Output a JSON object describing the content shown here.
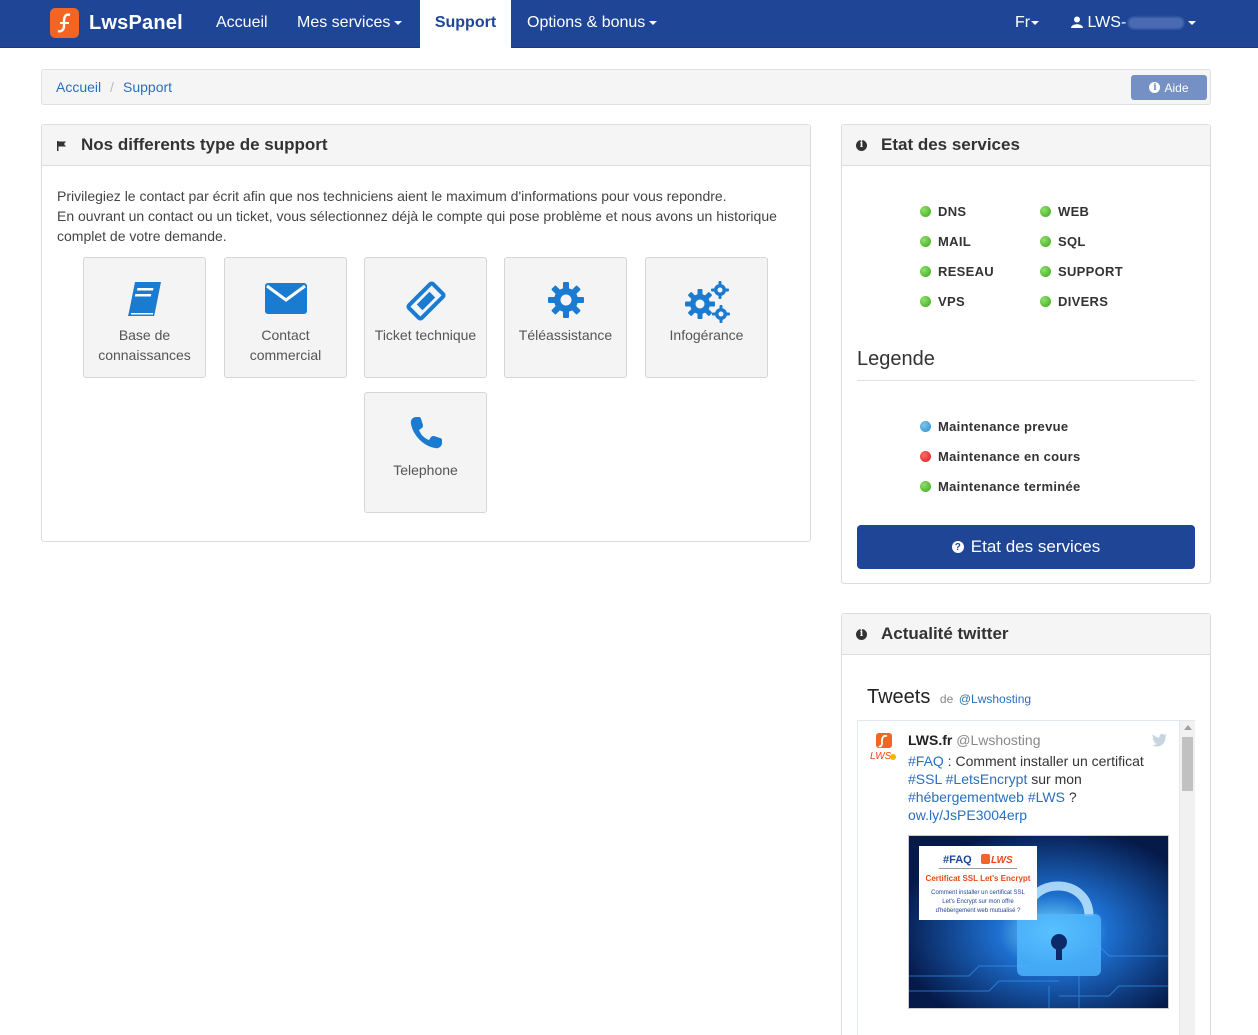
{
  "navbar": {
    "brand": "LwsPanel",
    "items": [
      {
        "label": "Accueil"
      },
      {
        "label": "Mes services"
      },
      {
        "label": "Support"
      },
      {
        "label": "Options & bonus"
      }
    ],
    "lang": "Fr",
    "user": "LWS-",
    "colors": {
      "primary": "#1e4596",
      "logo": "#f26522"
    }
  },
  "breadcrumb": {
    "home": "Accueil",
    "current": "Support",
    "aide": "Aide"
  },
  "support": {
    "title": "Nos differents type de support",
    "intro_line1": "Privilegiez le contact par écrit afin que nos techniciens aient le maximum d'informations pour vous repondre.",
    "intro_line2": "En ouvrant un contact ou un ticket, vous sélectionnez déjà le compte qui pose problème et nous avons un historique complet de votre demande.",
    "tiles": [
      {
        "label": "Base de connaissances",
        "icon": "book-icon"
      },
      {
        "label": "Contact commercial",
        "icon": "envelope-icon"
      },
      {
        "label": "Ticket technique",
        "icon": "ticket-icon"
      },
      {
        "label": "Téléassistance",
        "icon": "gear-icon"
      },
      {
        "label": "Infogérance",
        "icon": "gears-icon"
      },
      {
        "label": "Telephone",
        "icon": "phone-icon"
      }
    ]
  },
  "etat": {
    "title": "Etat des services",
    "services_left": [
      "DNS",
      "MAIL",
      "RESEAU",
      "VPS"
    ],
    "services_right": [
      "WEB",
      "SQL",
      "SUPPORT",
      "DIVERS"
    ],
    "legend_title": "Legende",
    "legend": [
      {
        "label": "Maintenance prevue",
        "color": "blue"
      },
      {
        "label": "Maintenance en cours",
        "color": "red"
      },
      {
        "label": "Maintenance terminée",
        "color": "green"
      }
    ],
    "button": "Etat des services"
  },
  "twitter": {
    "title": "Actualité twitter",
    "tweets_label": "Tweets",
    "de": "de",
    "handle": "@Lwshosting",
    "tweet": {
      "author": "LWS.fr",
      "author_handle": "@Lwshosting",
      "t1": "#FAQ",
      "t2": " : Comment installer un certificat ",
      "t3": "#SSL",
      "t4": " ",
      "t5": "#LetsEncrypt",
      "t6": " sur mon ",
      "t7": "#hébergementweb",
      "t8": " ",
      "t9": "#LWS",
      "t10": " ?",
      "link": "ow.ly/JsPE3004erp",
      "image": {
        "faq": "#FAQ",
        "lws": "LWS",
        "heading": "Certificat SSL Let's Encrypt",
        "line1": "Comment installer un certificat SSL",
        "line2": "Let's Encrypt sur mon offre",
        "line3": "d'hébergement web mutualisé ?"
      }
    }
  }
}
